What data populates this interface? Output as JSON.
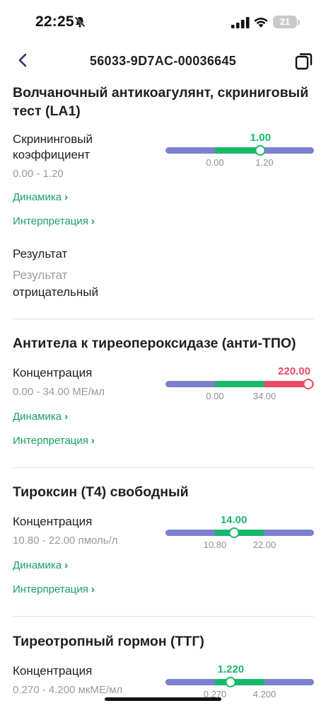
{
  "status_bar": {
    "time": "22:25",
    "battery": "21"
  },
  "header": {
    "title": "56033-9D7AC-00036645"
  },
  "links": {
    "dynamics": "Динамика",
    "interpretation": "Интерпретация"
  },
  "colors": {
    "normal": "#19b86b",
    "out_of_range": "#ea4a63",
    "outer_range": "#7c80cf",
    "link": "#1aa061"
  },
  "tests": [
    {
      "title": "Волчаночный антикоагулянт, скриниговый тест (LA1)",
      "param": "Скрининговый коэффициент",
      "range": "0.00 - 1.20",
      "gauge": {
        "value": "1.00",
        "low": "0.00",
        "high": "1.20",
        "status": "normal",
        "marker_fraction": 0.64
      },
      "result_label": "Результат",
      "result_prefix": "Результат",
      "result_value": "отрицательный"
    },
    {
      "title": "Антитела к тиреопероксидазе (анти-ТПО)",
      "param": "Концентрация",
      "range": "0.00 - 34.00 МЕ/мл",
      "gauge": {
        "value": "220.00",
        "low": "0.00",
        "high": "34.00",
        "status": "high",
        "marker_fraction": 1.0
      }
    },
    {
      "title": "Тироксин (Т4) свободный",
      "param": "Концентрация",
      "range": "10.80 - 22.00 пмоль/л",
      "gauge": {
        "value": "14.00",
        "low": "10.80",
        "high": "22.00",
        "status": "normal",
        "marker_fraction": 0.46
      }
    },
    {
      "title": "Тиреотропный гормон (ТТГ)",
      "param": "Концентрация",
      "range": "0.270 - 4.200 мкМЕ/мл",
      "gauge": {
        "value": "1.220",
        "low": "0.270",
        "high": "4.200",
        "status": "normal",
        "marker_fraction": 0.44
      }
    }
  ]
}
